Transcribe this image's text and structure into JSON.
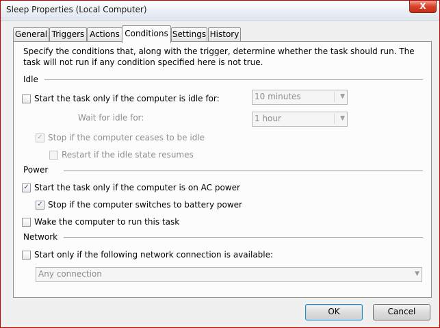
{
  "window": {
    "title": "Sleep Properties (Local Computer)",
    "close_glyph": "X"
  },
  "tabs": [
    "General",
    "Triggers",
    "Actions",
    "Conditions",
    "Settings",
    "History"
  ],
  "active_tab": "Conditions",
  "description": "Specify the conditions that, along with the trigger, determine whether the task should run.  The task will not run  if any condition specified here is not true.",
  "idle": {
    "heading": "Idle",
    "start_if_idle_label": "Start the task only if the computer is idle for:",
    "start_if_idle_checked": false,
    "idle_duration_value": "10 minutes",
    "wait_label": "Wait for idle for:",
    "wait_value": "1 hour",
    "stop_if_ceases_label": "Stop if the computer ceases to be idle",
    "stop_if_ceases_checked": true,
    "restart_label": "Restart if the idle state resumes",
    "restart_checked": false
  },
  "power": {
    "heading": "Power",
    "ac_power_label": "Start the task only if the computer is on AC power",
    "ac_power_checked": true,
    "battery_label": "Stop if the computer switches to battery power",
    "battery_checked": true,
    "wake_label": "Wake the computer to run this task",
    "wake_checked": false
  },
  "network": {
    "heading": "Network",
    "network_label": "Start only if the following network connection is available:",
    "network_checked": false,
    "connection_value": "Any connection"
  },
  "buttons": {
    "ok": "OK",
    "cancel": "Cancel"
  },
  "icons": {
    "check": "✓",
    "dropdown_arrow": "▼"
  },
  "colors": {
    "window_border": "#c00000",
    "close_button": "#d9402a",
    "check_mark": "#2a3e8c",
    "disabled_text": "#8d8d8d"
  }
}
